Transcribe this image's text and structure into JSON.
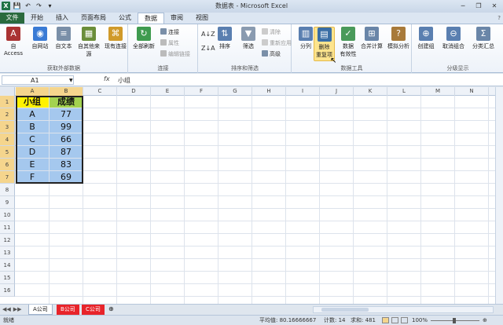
{
  "window": {
    "title": "数据表 - Microsoft Excel",
    "app_icon": "excel-logo-icon",
    "qat_icons": [
      "save-icon",
      "undo-icon",
      "redo-icon",
      "customize-icon"
    ],
    "controls": [
      "minimize-icon",
      "restore-icon",
      "close-icon"
    ]
  },
  "tabs": [
    {
      "label": "文件",
      "active": false
    },
    {
      "label": "开始",
      "active": false
    },
    {
      "label": "插入",
      "active": false
    },
    {
      "label": "页面布局",
      "active": false
    },
    {
      "label": "公式",
      "active": false
    },
    {
      "label": "数据",
      "active": true
    },
    {
      "label": "审阅",
      "active": false
    },
    {
      "label": "视图",
      "active": false
    }
  ],
  "ribbon": {
    "get_external": {
      "label": "获取外部数据",
      "buttons": [
        "自 Access",
        "自网站",
        "自文本",
        "自其他来源",
        "现有连接"
      ]
    },
    "connections": {
      "label": "连接",
      "refresh": "全部刷新",
      "items": [
        "连接",
        "属性",
        "编辑链接"
      ]
    },
    "sort_filter": {
      "label": "排序和筛选",
      "sort": "排序",
      "filter": "筛选",
      "items": [
        "清除",
        "重新应用",
        "高级"
      ]
    },
    "data_tools": {
      "label": "数据工具",
      "text_to_columns": "分列",
      "remove_duplicates_line1": "删除",
      "remove_duplicates_line2": "重复项",
      "validation_line1": "数据",
      "validation_line2": "有效性",
      "consolidate": "合并计算",
      "what_if": "模拟分析"
    },
    "outline": {
      "label": "分级显示",
      "group": "创建组",
      "ungroup": "取消组合",
      "subtotal": "分类汇总"
    }
  },
  "formula_bar": {
    "name_box": "A1",
    "fx": "fx",
    "value": "小组"
  },
  "columns": [
    "A",
    "B",
    "C",
    "D",
    "E",
    "F",
    "G",
    "H",
    "I",
    "J",
    "K",
    "L",
    "M",
    "N"
  ],
  "rows": [
    "1",
    "2",
    "3",
    "4",
    "5",
    "6",
    "7",
    "8",
    "9",
    "10",
    "11",
    "12",
    "13",
    "14",
    "15",
    "16"
  ],
  "table": {
    "header": [
      "小组",
      "成绩"
    ],
    "rows": [
      [
        "A",
        "77"
      ],
      [
        "B",
        "99"
      ],
      [
        "C",
        "66"
      ],
      [
        "D",
        "87"
      ],
      [
        "E",
        "83"
      ],
      [
        "F",
        "69"
      ]
    ]
  },
  "sheets": [
    {
      "label": "A公司",
      "active": true
    },
    {
      "label": "B公司",
      "active": false
    },
    {
      "label": "C公司",
      "active": false
    }
  ],
  "status": {
    "ready": "就绪",
    "average": "平均值: 80.16666667",
    "count": "计数: 14",
    "sum": "求和: 481",
    "zoom": "100%"
  },
  "colors": {
    "header_a": "#fff200",
    "header_b": "#a3d24f",
    "data_fill": "#a5c8ee",
    "file_tab": "#2a6a3e"
  }
}
